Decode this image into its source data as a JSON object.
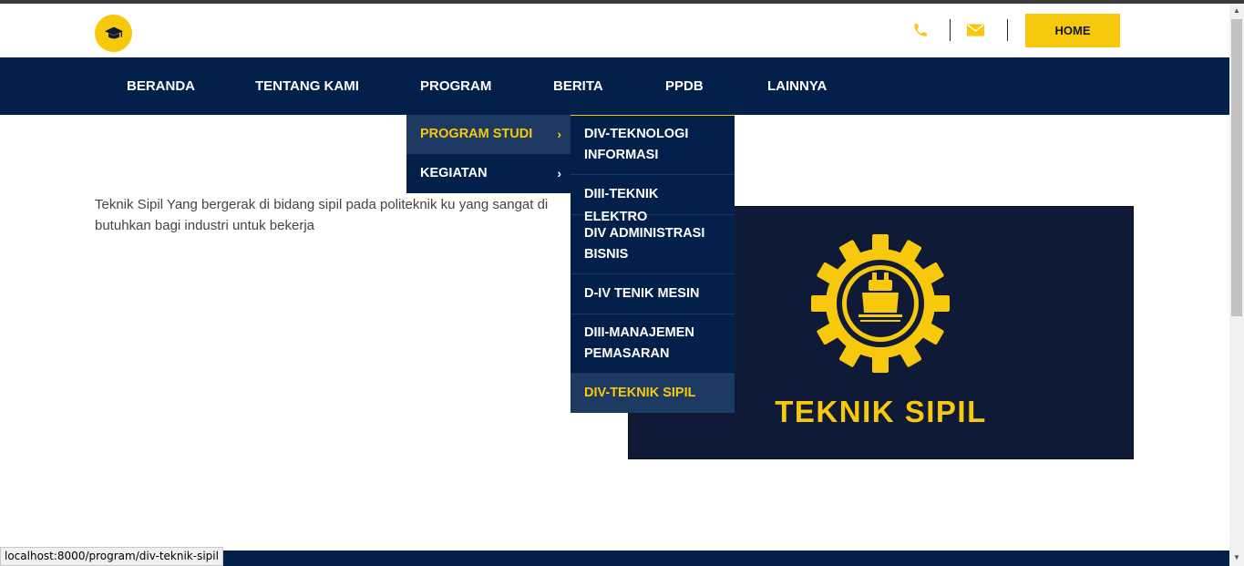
{
  "header": {
    "logo_icon": "graduation-cap-icon",
    "phone_icon": "phone-icon",
    "mail_icon": "envelope-icon",
    "home_label": "HOME",
    "accent_color": "#f8c80c",
    "navy_color": "#03204a"
  },
  "nav": {
    "items": [
      {
        "label": "BERANDA"
      },
      {
        "label": "TENTANG KAMI"
      },
      {
        "label": "PROGRAM"
      },
      {
        "label": "BERITA"
      },
      {
        "label": "PPDB"
      },
      {
        "label": "LAINNYA"
      }
    ]
  },
  "dropdown": {
    "items": [
      {
        "label": "PROGRAM STUDI",
        "chevron": "›"
      },
      {
        "label": "KEGIATAN",
        "chevron": "›"
      }
    ]
  },
  "submenu": {
    "items": [
      {
        "label": "DIV-TEKNOLOGI INFORMASI"
      },
      {
        "label": "DIII-TEKNIK ELEKTRO"
      },
      {
        "label": "DIV ADMINISTRASI BISNIS"
      },
      {
        "label": "D-IV TENIK MESIN"
      },
      {
        "label": "DIII-MANAJEMEN PEMASARAN"
      },
      {
        "label": "DIV-TEKNIK SIPIL"
      }
    ]
  },
  "content": {
    "description": "Teknik Sipil Yang bergerak di bidang sipil pada politeknik ku yang sangat di butuhkan bagi industri untuk bekerja",
    "image_title": "TEKNIK SIPIL"
  },
  "status_bar": {
    "url": "localhost:8000/program/div-teknik-sipil"
  }
}
